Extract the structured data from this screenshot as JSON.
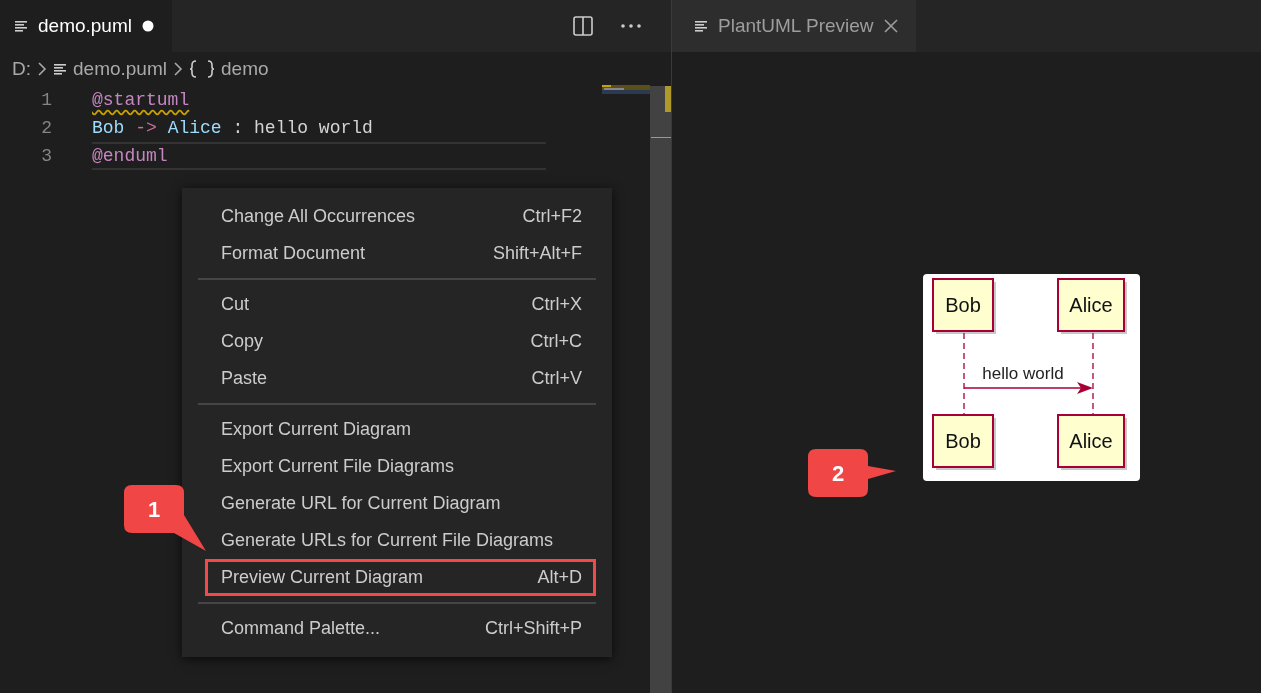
{
  "editor": {
    "tab": {
      "title": "demo.puml",
      "modified": true
    },
    "breadcrumbs": [
      {
        "kind": "drive",
        "label": "D:"
      },
      {
        "kind": "file",
        "label": "demo.puml"
      },
      {
        "kind": "symbol",
        "label": "demo"
      }
    ],
    "lines": [
      {
        "number": "1",
        "current": false,
        "tokens": [
          {
            "kind": "directive",
            "text": "@startuml",
            "warning": true
          }
        ]
      },
      {
        "number": "2",
        "current": false,
        "tokens": [
          {
            "kind": "name",
            "text": "Bob",
            "warning": false
          },
          {
            "kind": "operator",
            "text": " -> ",
            "warning": false
          },
          {
            "kind": "name",
            "text": "Alice",
            "warning": false
          },
          {
            "kind": "plain",
            "text": " : hello world",
            "warning": false
          }
        ]
      },
      {
        "number": "3",
        "current": true,
        "tokens": [
          {
            "kind": "directive",
            "text": "@enduml",
            "warning": false
          }
        ]
      }
    ]
  },
  "context_menu": {
    "groups": [
      [
        {
          "label": "Change All Occurrences",
          "shortcut": "Ctrl+F2",
          "highlighted": false
        },
        {
          "label": "Format Document",
          "shortcut": "Shift+Alt+F",
          "highlighted": false
        }
      ],
      [
        {
          "label": "Cut",
          "shortcut": "Ctrl+X",
          "highlighted": false
        },
        {
          "label": "Copy",
          "shortcut": "Ctrl+C",
          "highlighted": false
        },
        {
          "label": "Paste",
          "shortcut": "Ctrl+V",
          "highlighted": false
        }
      ],
      [
        {
          "label": "Export Current Diagram",
          "highlighted": false
        },
        {
          "label": "Export Current File Diagrams",
          "highlighted": false
        },
        {
          "label": "Generate URL for Current Diagram",
          "highlighted": false
        },
        {
          "label": "Generate URLs for Current File Diagrams",
          "highlighted": false
        },
        {
          "label": "Preview Current Diagram",
          "shortcut": "Alt+D",
          "highlighted": true
        }
      ],
      [
        {
          "label": "Command Palette...",
          "shortcut": "Ctrl+Shift+P",
          "highlighted": false
        }
      ]
    ]
  },
  "callouts": [
    {
      "label": "1"
    },
    {
      "label": "2"
    }
  ],
  "preview": {
    "tab": {
      "title": "PlantUML Preview"
    },
    "diagram": {
      "participants": [
        "Bob",
        "Alice"
      ],
      "footer_participants": [
        "Bob",
        "Alice"
      ],
      "message": "hello world"
    }
  }
}
